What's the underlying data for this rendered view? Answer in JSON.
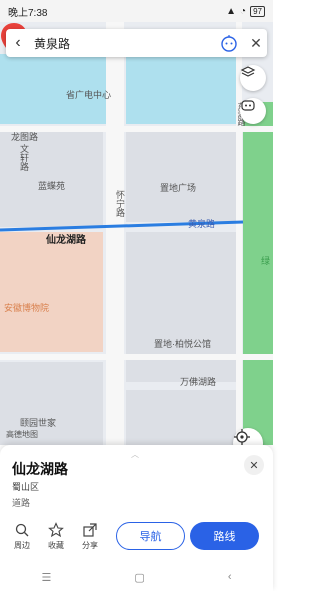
{
  "status_bar": {
    "time": "晚上7:38",
    "battery": "97"
  },
  "search": {
    "query": "黄泉路"
  },
  "map": {
    "labels": {
      "provincial_tv_center": "省广电中心",
      "longfei_road": "龙图路",
      "wenxuan_road": "文轩路",
      "lanhuiyuan": "蓝蝶苑",
      "huaining_road": "怀宁路",
      "zhidi_plaza": "置地广场",
      "huangquan_road": "黄泉路",
      "xianlong_lake_road": "仙龙湖路",
      "anhui_expo_center": "安徽博物院",
      "zhidi_baiyue": "置地·柏悦公馆",
      "fangfo_lake_road": "万佛湖路",
      "yiyuan_shijie": "颐园世家",
      "gao_de_map": "高德地图",
      "green_area": "绿",
      "east_road": "东湖路"
    },
    "colors": {
      "water": "#aee0ee",
      "park": "#7fd18c",
      "block": "#dcdfe5",
      "expo": "#f2d3c4",
      "route": "#2a7de1"
    }
  },
  "place": {
    "title": "仙龙湖路",
    "district": "蜀山区",
    "category": "道路"
  },
  "actions": {
    "nearby": "周边",
    "favorite": "收藏",
    "share": "分享",
    "navigate": "导航",
    "route": "路线"
  },
  "icons": [
    "back-arrow-icon",
    "assistant-bot-icon",
    "close-icon",
    "layers-icon",
    "chat-icon",
    "locate-icon",
    "search-icon",
    "star-icon",
    "share-icon",
    "menu-icon",
    "home-icon",
    "back-icon"
  ]
}
